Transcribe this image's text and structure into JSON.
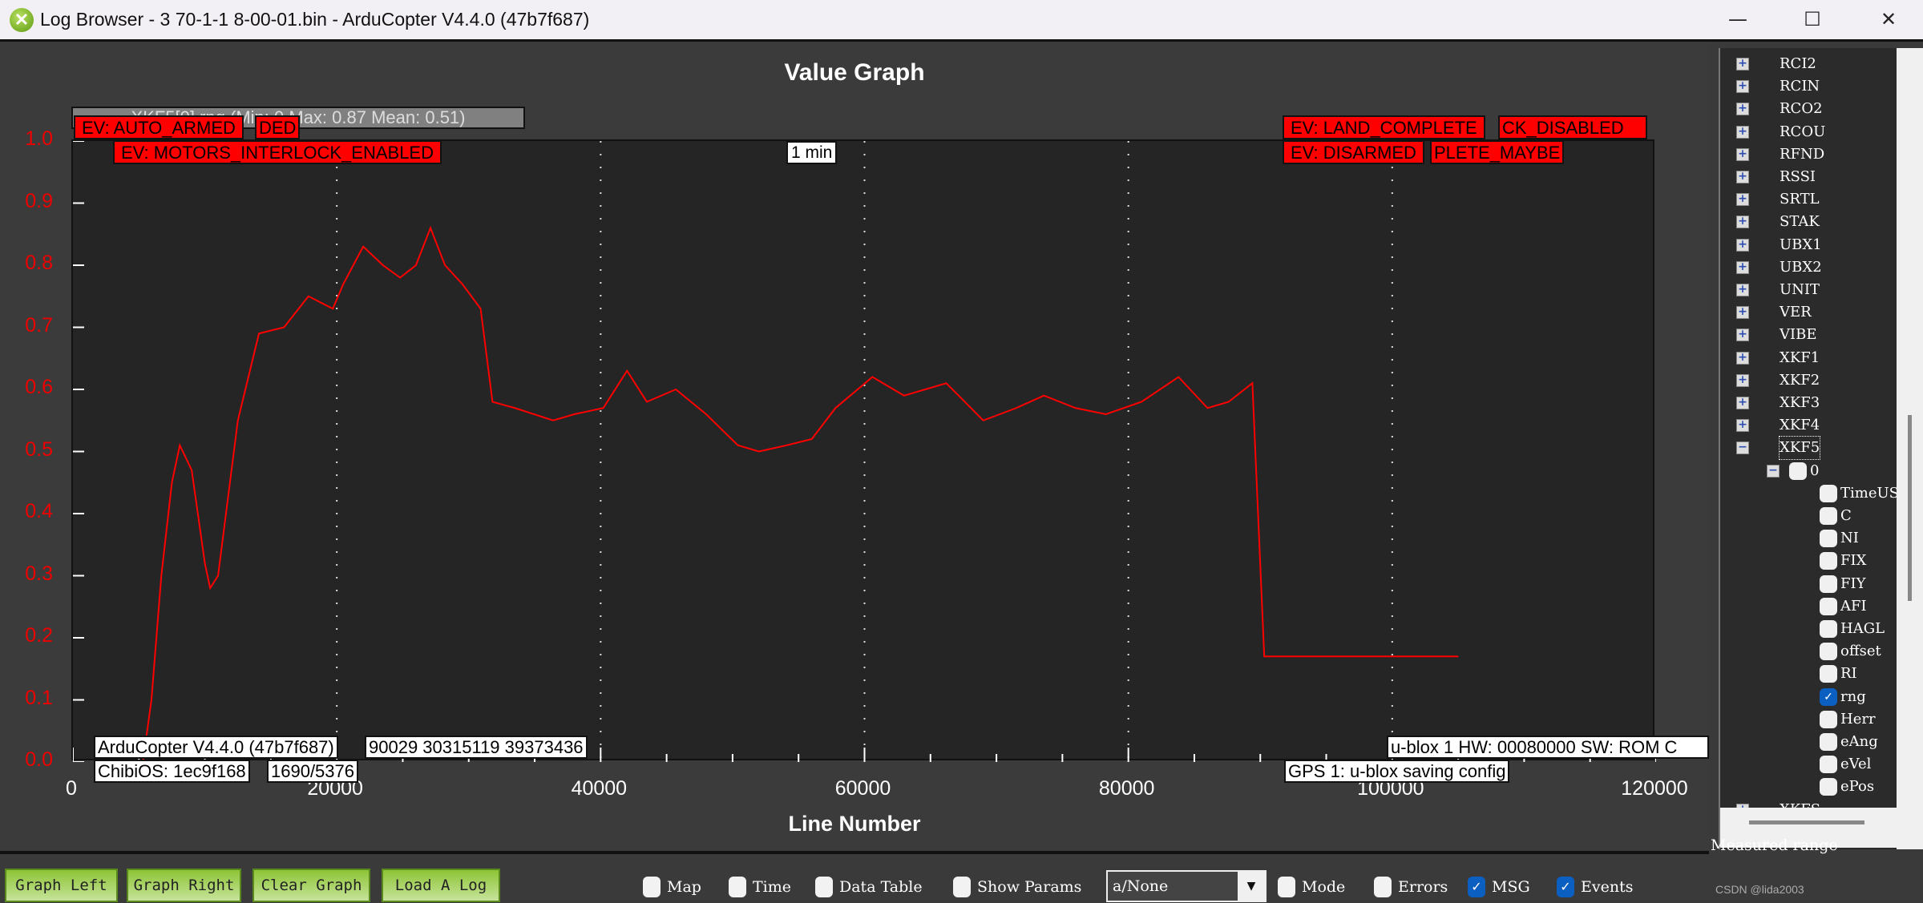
{
  "window": {
    "title": "Log Browser - 3 70-1-1 8-00-01.bin - ArduCopter V4.4.0 (47b7f687)",
    "minimize": "—",
    "maximize": "☐",
    "close": "✕"
  },
  "graph": {
    "title": "Value Graph",
    "legend": "XKF5[0].rng (Min: 0 Max: 0.87 Mean: 0.51)",
    "time_marker": "1 min",
    "events": [
      "EV: AUTO_ARMED",
      "DED",
      "EV: MOTORS_INTERLOCK_ENABLED",
      "EV: LAND_COMPLETE",
      "CK_DISABLED",
      "EV: DISARMED",
      "PLETE_MAYBE"
    ],
    "info": [
      "ArduCopter V4.4.0 (47b7f687)",
      "90029 30315119 39373436",
      "ChibiOS: 1ec9f168",
      "1690/5376",
      "u-blox 1 HW: 00080000 SW: ROM C",
      "GPS 1: u-blox saving config"
    ]
  },
  "chart_data": {
    "type": "line",
    "title": "Value Graph",
    "xlabel": "Line Number",
    "ylabel": "",
    "xlim": [
      0,
      120000
    ],
    "ylim": [
      0,
      1.0
    ],
    "xticks": [
      "0",
      "20000",
      "40000",
      "60000",
      "80000",
      "100000",
      "120000"
    ],
    "yticks": [
      "0.0",
      "0.1",
      "0.2",
      "0.3",
      "0.4",
      "0.5",
      "0.6",
      "0.7",
      "0.8",
      "0.9",
      "1.0"
    ],
    "grid": "vertical dotted",
    "color": "#ff0000",
    "series": [
      {
        "name": "XKF5[0].rng",
        "x": [
          5300,
          5950,
          6700,
          7500,
          8100,
          9000,
          10000,
          10400,
          11000,
          12500,
          14100,
          16000,
          17850,
          19700,
          20500,
          22000,
          23500,
          24800,
          26000,
          27100,
          28200,
          29500,
          30900,
          31800,
          33500,
          36400,
          38000,
          40200,
          42000,
          43500,
          45700,
          48000,
          50400,
          52000,
          54100,
          56000,
          57800,
          60600,
          63000,
          66200,
          69000,
          71500,
          73600,
          76000,
          78300,
          81000,
          83800,
          86000,
          87600,
          89400,
          90300,
          95000,
          100000,
          105000
        ],
        "y": [
          0,
          0.1,
          0.3,
          0.45,
          0.51,
          0.47,
          0.32,
          0.28,
          0.3,
          0.55,
          0.69,
          0.7,
          0.75,
          0.73,
          0.77,
          0.83,
          0.8,
          0.78,
          0.8,
          0.86,
          0.8,
          0.77,
          0.73,
          0.58,
          0.57,
          0.55,
          0.56,
          0.57,
          0.63,
          0.58,
          0.6,
          0.56,
          0.51,
          0.5,
          0.51,
          0.52,
          0.57,
          0.62,
          0.59,
          0.61,
          0.55,
          0.57,
          0.59,
          0.57,
          0.56,
          0.58,
          0.62,
          0.57,
          0.58,
          0.61,
          0.17,
          0.17,
          0.17,
          0.17
        ]
      }
    ]
  },
  "toolbar": {
    "buttons": [
      "Graph Left",
      "Graph Right",
      "Clear Graph",
      "Load A Log"
    ],
    "checks": [
      {
        "label": "Map",
        "checked": false
      },
      {
        "label": "Time",
        "checked": false
      },
      {
        "label": "Data Table",
        "checked": false
      },
      {
        "label": "Show Params",
        "checked": false
      },
      {
        "label": "Mode",
        "checked": false
      },
      {
        "label": "Errors",
        "checked": false
      },
      {
        "label": "MSG",
        "checked": true
      },
      {
        "label": "Events",
        "checked": true
      }
    ],
    "dropdown_value": "a/None"
  },
  "tree": {
    "groups": [
      "RCI2",
      "RCIN",
      "RCO2",
      "RCOU",
      "RFND",
      "RSSI",
      "SRTL",
      "STAK",
      "UBX1",
      "UBX2",
      "UNIT",
      "VER",
      "VIBE",
      "XKF1",
      "XKF2",
      "XKF3",
      "XKF4",
      "XKF5"
    ],
    "instance": "0",
    "fields": [
      {
        "label": "TimeUS",
        "checked": false
      },
      {
        "label": "C",
        "checked": false
      },
      {
        "label": "NI",
        "checked": false
      },
      {
        "label": "FIX",
        "checked": false
      },
      {
        "label": "FIY",
        "checked": false
      },
      {
        "label": "AFI",
        "checked": false
      },
      {
        "label": "HAGL",
        "checked": false
      },
      {
        "label": "offset",
        "checked": false
      },
      {
        "label": "RI",
        "checked": false
      },
      {
        "label": "rng",
        "checked": true
      },
      {
        "label": "Herr",
        "checked": false
      },
      {
        "label": "eAng",
        "checked": false
      },
      {
        "label": "eVel",
        "checked": false
      },
      {
        "label": "ePos",
        "checked": false
      }
    ],
    "after": "XKFS"
  },
  "status": "Measured range",
  "watermark": "CSDN @lida2003"
}
